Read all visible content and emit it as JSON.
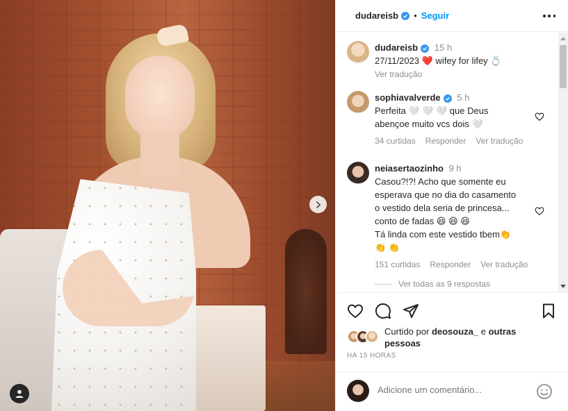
{
  "post": {
    "username": "dudareisb",
    "follow_label": "Seguir",
    "separator": "•",
    "caption_time": "15 h",
    "caption_text_1": "27/11/2023",
    "caption_emoji_heart": "❤️",
    "caption_text_2": "wifey for lifey",
    "caption_emoji_ring": "💍",
    "see_translation": "Ver tradução"
  },
  "comments": [
    {
      "username": "sophiavalverde",
      "time": "5 h",
      "text_line1": "Perfeita 🤍 🤍 🤍 que Deus",
      "text_line2": "abençoe muito vcs dois 🤍",
      "likes": "34 curtidas",
      "reply": "Responder",
      "translate": "Ver tradução"
    },
    {
      "username": "neiasertaozinho",
      "time": "9 h",
      "text_line1": "Casou?!?! Acho que somente eu",
      "text_line2": "esperava que no dia do casamento",
      "text_line3": "o vestido dela seria de princesa...",
      "text_line4": "conto de fadas 😆 😆 😆",
      "text_line5": "Tá linda com este vestido tbem👏",
      "text_line6": "👏 👏",
      "likes": "151 curtidas",
      "reply": "Responder",
      "translate": "Ver tradução"
    }
  ],
  "view_replies": "Ver todas as 9 respostas",
  "likes": {
    "prefix": "Curtido por",
    "user": "deosouza_",
    "middle": "e",
    "suffix": "outras pessoas"
  },
  "time_ago": "HÁ 15 HORAS",
  "add_comment_placeholder": "Adicione um comentário...",
  "colors": {
    "accent": "#0095f6",
    "verified": "#3897f0",
    "muted": "#8e8e8e",
    "heart_red": "#ed4956"
  }
}
